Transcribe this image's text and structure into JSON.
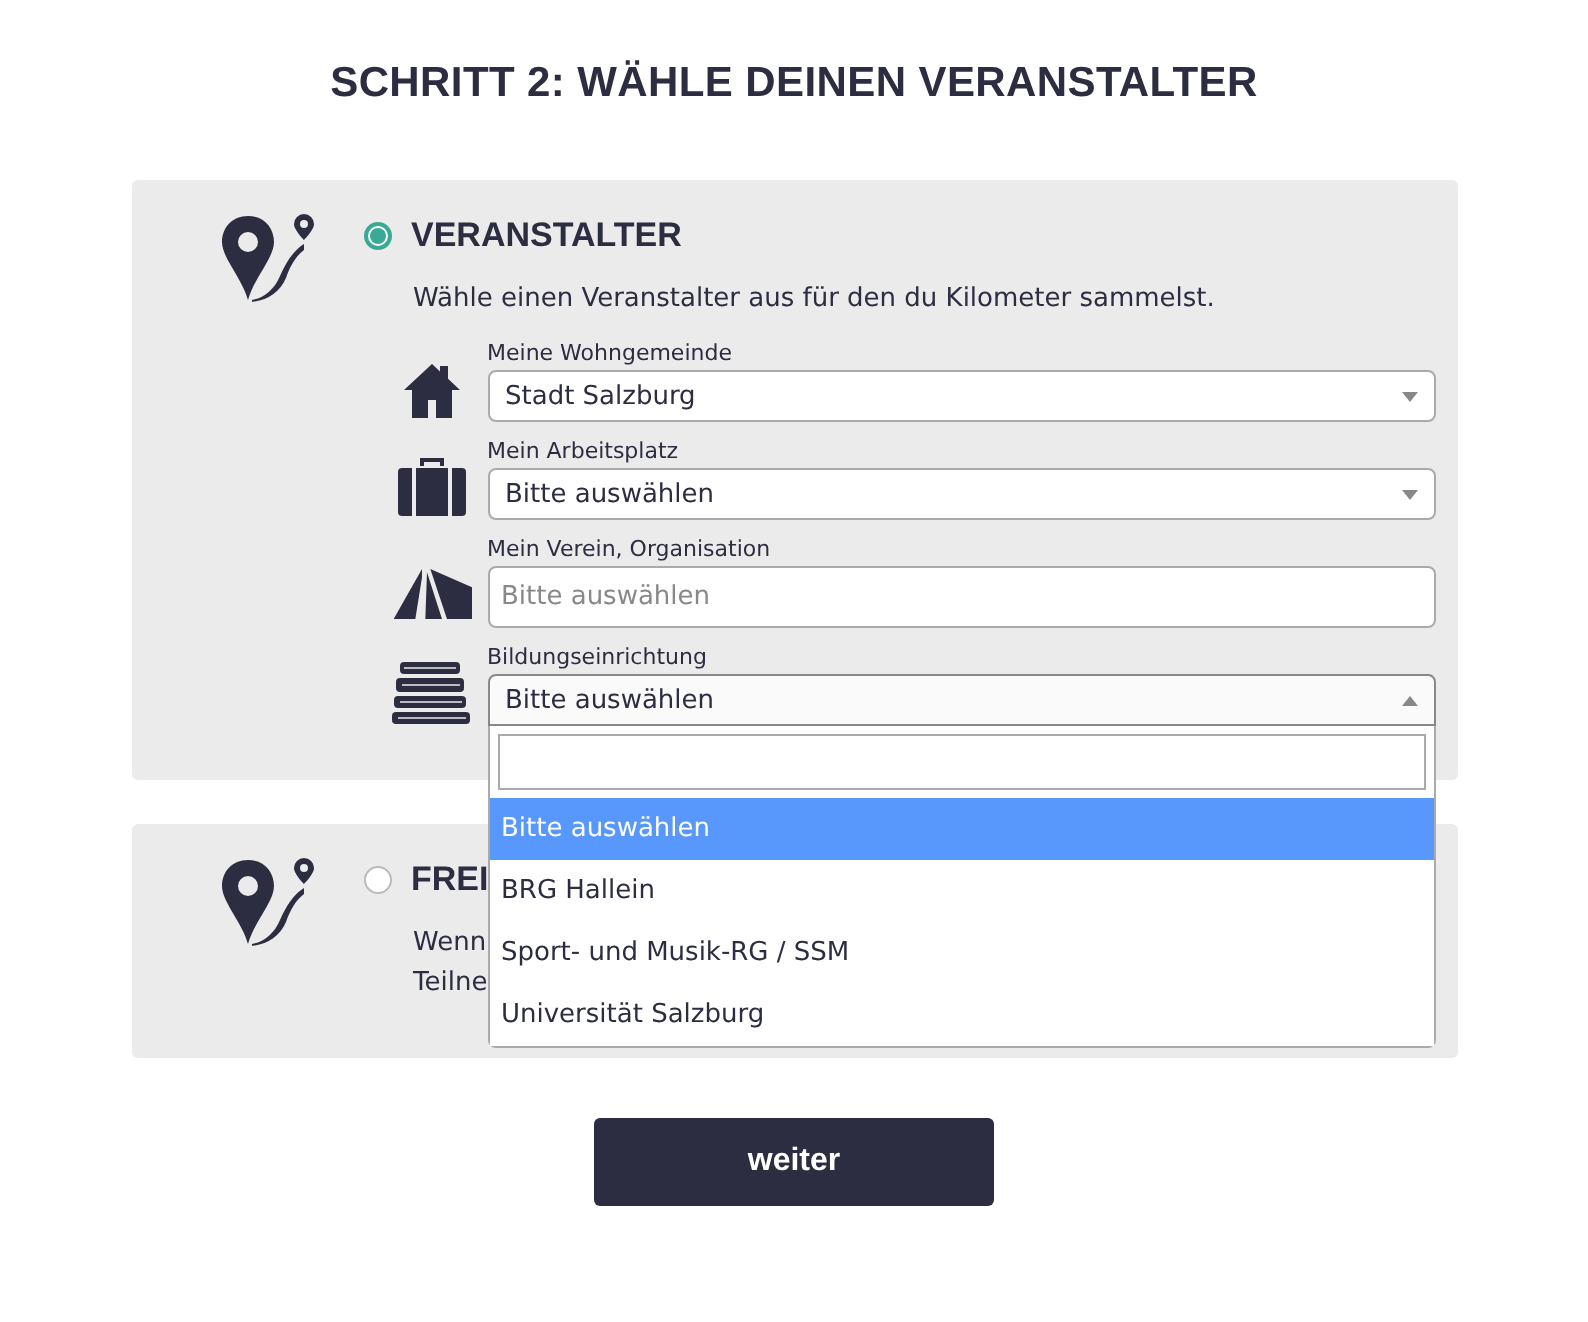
{
  "heading": "SCHRITT 2: WÄHLE DEINEN VERANSTALTER",
  "options": [
    {
      "title": "VERANSTALTER",
      "selected": true,
      "description_lines": [
        "Wähle einen Veranstalter aus für den du Kilometer sammelst."
      ],
      "fields": [
        {
          "kind": "select",
          "label": "Meine Wohngemeinde",
          "value": "Stadt Salzburg",
          "open": false
        },
        {
          "kind": "select",
          "label": "Mein Arbeitsplatz",
          "value": "Bitte auswählen",
          "open": false
        },
        {
          "kind": "input",
          "label": "Mein Verein, Organisation",
          "placeholder": "Bitte auswählen"
        },
        {
          "kind": "select",
          "label": "Bildungseinrichtung",
          "value": "Bitte auswählen",
          "open": true,
          "dropdown": [
            {
              "label": "Bitte auswählen",
              "selected": true
            },
            {
              "label": "BRG Hallein",
              "selected": false
            },
            {
              "label": "Sport- und Musik-RG / SSM",
              "selected": false
            },
            {
              "label": "Universität Salzburg",
              "selected": false
            }
          ]
        }
      ]
    },
    {
      "title": "FREI",
      "selected": false,
      "description_lines": [
        "Wenn",
        "Teilne"
      ]
    }
  ],
  "next_button": "weiter"
}
